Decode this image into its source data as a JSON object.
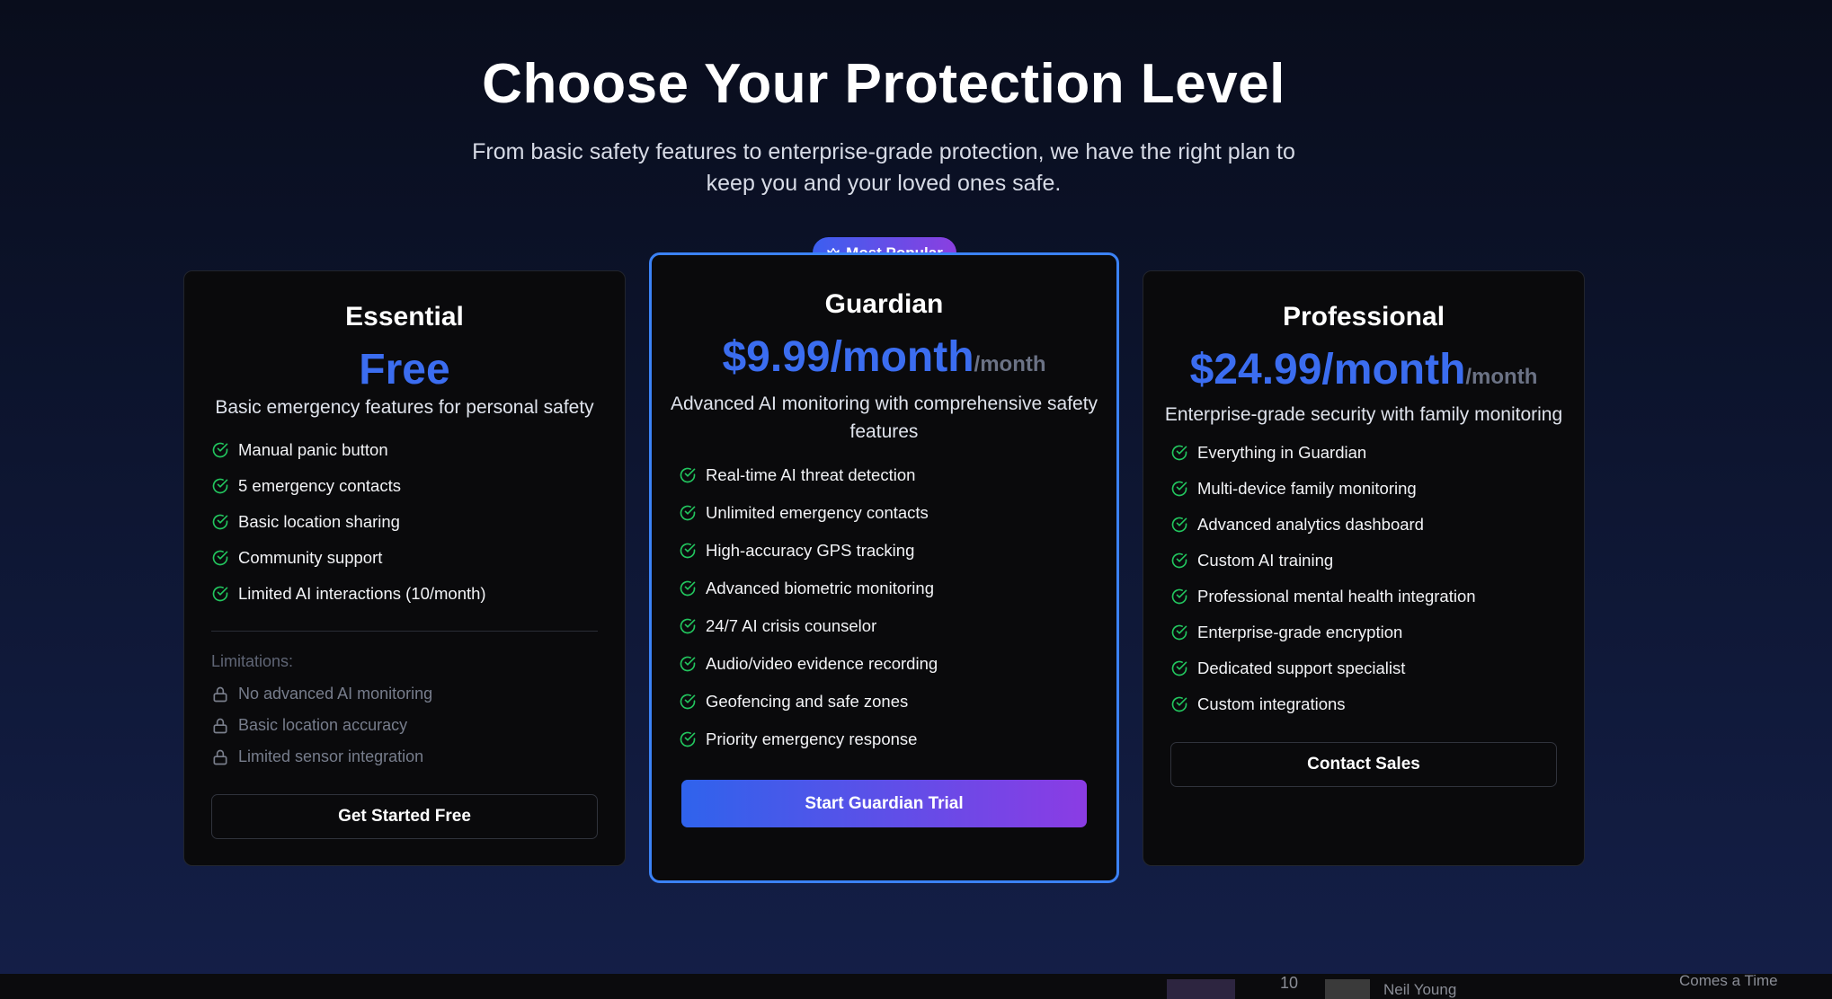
{
  "header": {
    "title": "Choose Your Protection Level",
    "subtitle": "From basic safety features to enterprise-grade protection, we have the right plan to keep you and your loved ones safe."
  },
  "colors": {
    "accent": "#3b6df0",
    "featured_border": "#3b82f6",
    "check": "#22c55e",
    "gradient_start": "#2f63ec",
    "gradient_end": "#8b3ce4"
  },
  "plans": {
    "essential": {
      "name": "Essential",
      "price": "Free",
      "description": "Basic emergency features for personal safety",
      "features": [
        "Manual panic button",
        "5 emergency contacts",
        "Basic location sharing",
        "Community support",
        "Limited AI interactions (10/month)"
      ],
      "limitations_title": "Limitations:",
      "limitations": [
        "No advanced AI monitoring",
        "Basic location accuracy",
        "Limited sensor integration"
      ],
      "cta": "Get Started Free"
    },
    "guardian": {
      "badge": "Most Popular",
      "badge_icon": "crown-icon",
      "name": "Guardian",
      "price": "$9.99/month",
      "period": "/month",
      "description": "Advanced AI monitoring with comprehensive safety features",
      "features": [
        "Real-time AI threat detection",
        "Unlimited emergency contacts",
        "High-accuracy GPS tracking",
        "Advanced biometric monitoring",
        "24/7 AI crisis counselor",
        "Audio/video evidence recording",
        "Geofencing and safe zones",
        "Priority emergency response"
      ],
      "cta": "Start Guardian Trial"
    },
    "professional": {
      "name": "Professional",
      "price": "$24.99/month",
      "period": "/month",
      "description": "Enterprise-grade security with family monitoring",
      "features": [
        "Everything in Guardian",
        "Multi-device family monitoring",
        "Advanced analytics dashboard",
        "Custom AI training",
        "Professional mental health integration",
        "Enterprise-grade encryption",
        "Dedicated support specialist",
        "Custom integrations"
      ],
      "cta": "Contact Sales"
    }
  },
  "bottom_strip": {
    "track_number": "10",
    "artist": "Neil Young",
    "song": "Comes a Time"
  }
}
